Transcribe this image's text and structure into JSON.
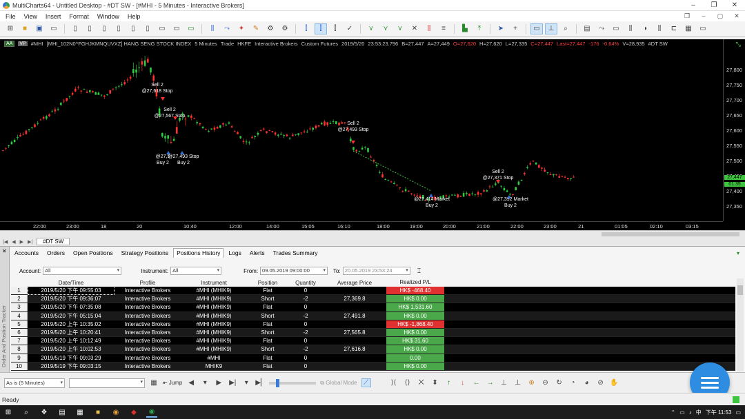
{
  "window": {
    "title": "MultiCharts64 - Untitled Desktop - #DT SW - [#MHI - 5 Minutes - Interactive Brokers]"
  },
  "menu": [
    "File",
    "View",
    "Insert",
    "Format",
    "Window",
    "Help"
  ],
  "chart": {
    "header": {
      "badge_aa": "AA",
      "badge_vp": "VP",
      "symbol_short": "#MHI",
      "instrument": "[MHI_102N0^FGHJKMNQUVXZ] HANG SENG STOCK INDEX",
      "resolution": "5 Minutes",
      "mode": "Trade",
      "exchange": "HKFE",
      "broker": "Interactive Brokers",
      "session": "Custom Futures",
      "datetime": "2019/5/20",
      "time": "23:53:23.796",
      "bid": "B=27,447",
      "ask": "A=27,449",
      "open": "O=27,620",
      "high": "H=27,620",
      "low": "L=27,335",
      "close": "C=27,447",
      "last": "Last=27,447",
      "change": "-176",
      "change_pct": "-0.64%",
      "volume": "V=28,935",
      "desktop": "#DT SW"
    },
    "price_labels": [
      "27,800",
      "27,750",
      "27,700",
      "27,650",
      "27,600",
      "27,550",
      "27,500",
      "27,450",
      "27,400",
      "27,350"
    ],
    "current_price": "27,447",
    "current_time_tag": "01:35",
    "time_labels": [
      "22:00",
      "23:00",
      "18",
      "20",
      "10:40",
      "12:00",
      "14:00",
      "15:05",
      "16:10",
      "18:00",
      "19:00",
      "20:00",
      "21:00",
      "22:00",
      "23:00",
      "21",
      "01:05",
      "02:10",
      "03:15"
    ],
    "annotations": [
      {
        "l1": "Sell 2",
        "l2": "@27,618 Stop"
      },
      {
        "l1": "Sell 2",
        "l2": "@27,567 Stop"
      },
      {
        "l1": "@27,5",
        "l2": "Buy 2"
      },
      {
        "l1": "@27,493 Stop",
        "l2": "Buy 2"
      },
      {
        "l1": "Sell 2",
        "l2": "@27,493 Stop"
      },
      {
        "l1": "@27,414 Market",
        "l2": "Buy 2"
      },
      {
        "l1": "Sell 2",
        "l2": "@27,371 Stop"
      },
      {
        "l1": "@27,392 Market",
        "l2": "Buy 2"
      }
    ]
  },
  "chart_tab": "#DT SW",
  "omp": {
    "side_title": "Order And Position Tracker",
    "tabs": [
      "Accounts",
      "Orders",
      "Open Positions",
      "Strategy Positions",
      "Positions History",
      "Logs",
      "Alerts",
      "Trades Summary"
    ],
    "filters": {
      "account_label": "Account:",
      "account_value": "All",
      "instrument_label": "Instrument:",
      "instrument_value": "All",
      "from_label": "From:",
      "from_value": "09.05.2019 09:00:00",
      "to_label": "To:",
      "to_value": "20.05.2019 23:53:24"
    },
    "columns": [
      "Date/Time",
      "Profile",
      "Instrument",
      "Position",
      "Quantity",
      "Average Price",
      "Realized P/L"
    ],
    "rows": [
      {
        "n": "1",
        "dt": "2019/5/20 下午 09:55:03",
        "profile": "Interactive Brokers",
        "inst": "#MHI (MHIK9)",
        "pos": "Flat",
        "qty": "0",
        "avg": "",
        "pl": "HK$ -468.40",
        "neg": true
      },
      {
        "n": "2",
        "dt": "2019/5/20 下午 09:36:07",
        "profile": "Interactive Brokers",
        "inst": "#MHI (MHIK9)",
        "pos": "Short",
        "qty": "-2",
        "avg": "27,369.8",
        "pl": "HK$ 0.00",
        "neg": false
      },
      {
        "n": "3",
        "dt": "2019/5/20 下午 07:35:08",
        "profile": "Interactive Brokers",
        "inst": "#MHI (MHIK9)",
        "pos": "Flat",
        "qty": "0",
        "avg": "",
        "pl": "HK$ 1,531.60",
        "neg": false
      },
      {
        "n": "4",
        "dt": "2019/5/20 下午 05:15:04",
        "profile": "Interactive Brokers",
        "inst": "#MHI (MHIK9)",
        "pos": "Short",
        "qty": "-2",
        "avg": "27,491.8",
        "pl": "HK$ 0.00",
        "neg": false
      },
      {
        "n": "5",
        "dt": "2019/5/20 上午 10:35:02",
        "profile": "Interactive Brokers",
        "inst": "#MHI (MHIK9)",
        "pos": "Flat",
        "qty": "0",
        "avg": "",
        "pl": "HK$ -1,868.40",
        "neg": true
      },
      {
        "n": "6",
        "dt": "2019/5/20 上午 10:20:41",
        "profile": "Interactive Brokers",
        "inst": "#MHI (MHIK9)",
        "pos": "Short",
        "qty": "-2",
        "avg": "27,565.8",
        "pl": "HK$ 0.00",
        "neg": false
      },
      {
        "n": "7",
        "dt": "2019/5/20 上午 10:12:49",
        "profile": "Interactive Brokers",
        "inst": "#MHI (MHIK9)",
        "pos": "Flat",
        "qty": "0",
        "avg": "",
        "pl": "HK$ 31.60",
        "neg": false
      },
      {
        "n": "8",
        "dt": "2019/5/20 上午 10:02:53",
        "profile": "Interactive Brokers",
        "inst": "#MHI (MHIK9)",
        "pos": "Short",
        "qty": "-2",
        "avg": "27,616.8",
        "pl": "HK$ 0.00",
        "neg": false
      },
      {
        "n": "9",
        "dt": "2019/5/19 下午 09:03:29",
        "profile": "Interactive Brokers",
        "inst": "#MHI",
        "pos": "Flat",
        "qty": "0",
        "avg": "",
        "pl": "0.00",
        "neg": false
      },
      {
        "n": "10",
        "dt": "2019/5/19 下午 09:03:15",
        "profile": "Interactive Brokers",
        "inst": "MHIK9",
        "pos": "Flat",
        "qty": "0",
        "avg": "",
        "pl": "HK$ 0.00",
        "neg": false
      }
    ]
  },
  "bottombar": {
    "resolution_select": "As is (5 Minutes)",
    "jump_label": "Jump",
    "global_mode_label": "Global Mode"
  },
  "status": "Ready",
  "taskbar": {
    "time": "下午 11:53"
  }
}
